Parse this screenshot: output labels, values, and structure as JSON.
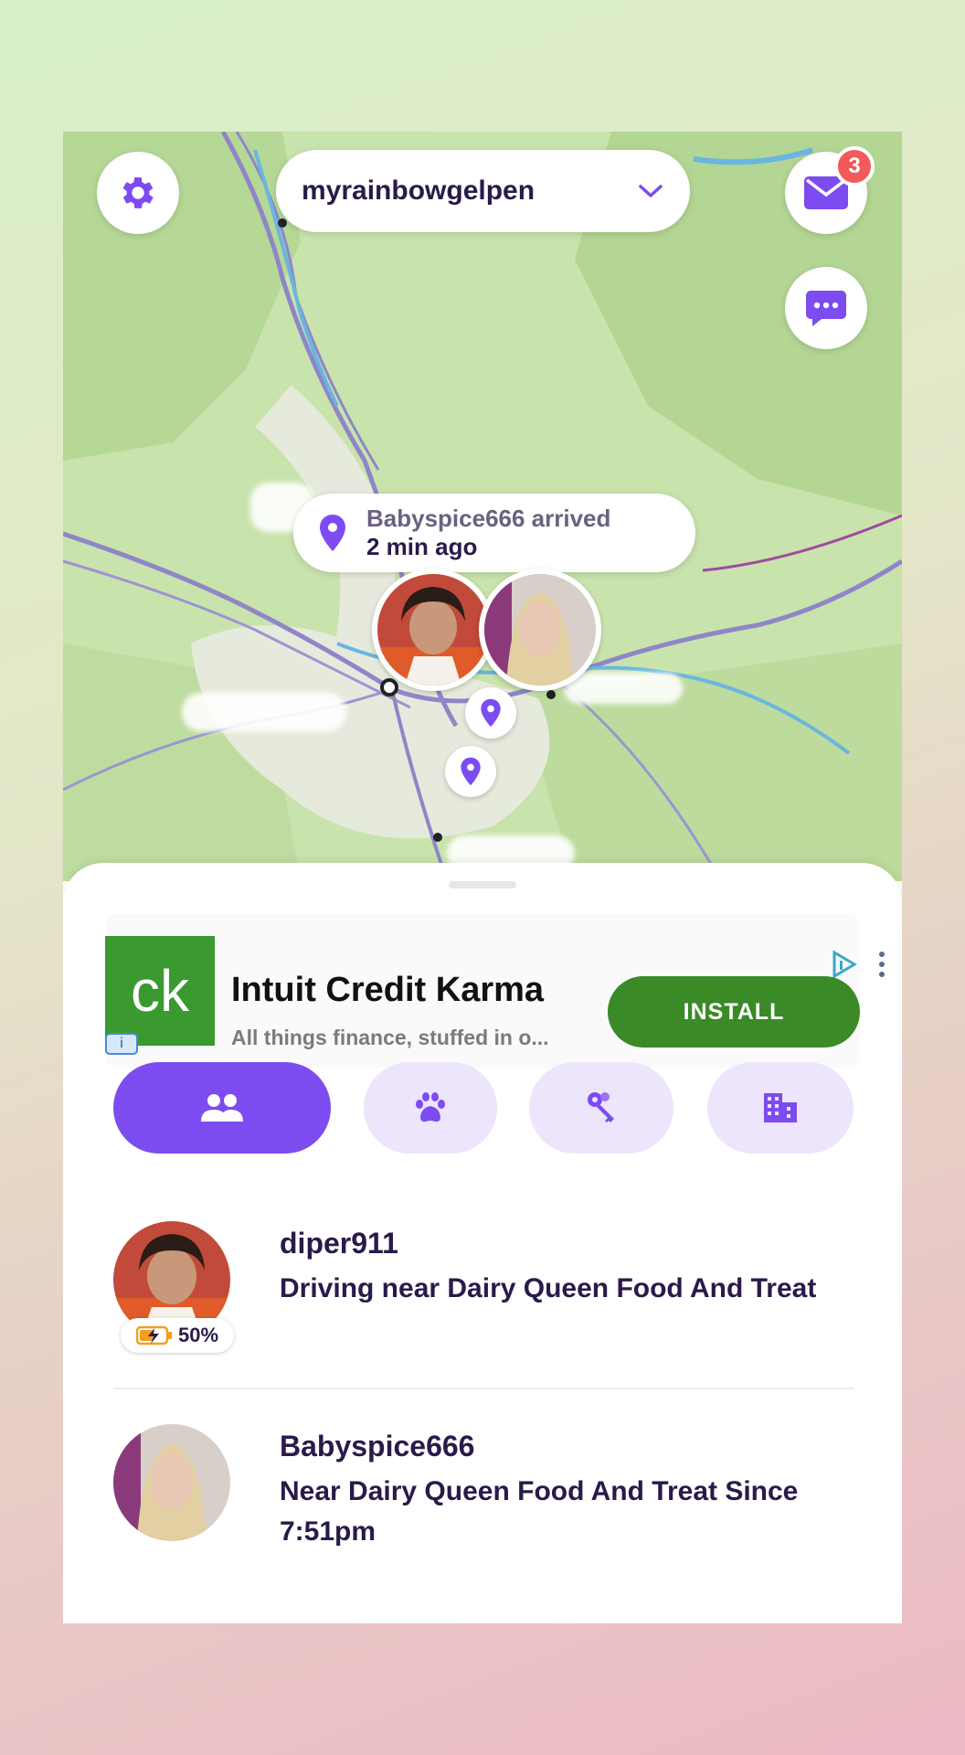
{
  "colors": {
    "accent": "#7c4cf0",
    "tab_inactive": "#ece5fb",
    "text_dark": "#2a1a4a",
    "badge": "#f05a5a",
    "ad_green": "#3a8a28"
  },
  "header": {
    "circle_name": "myrainbowgelpen",
    "mail_badge": "3",
    "icons": [
      "gear-icon",
      "chevron-down-icon",
      "mail-icon",
      "chat-icon"
    ]
  },
  "map": {
    "arrival_title": "Babyspice666 arrived",
    "arrival_time": "2 min ago"
  },
  "ad": {
    "logo_text": "ck",
    "title": "Intuit Credit Karma",
    "subtitle": "All things finance, stuffed in o...",
    "install_label": "INSTALL",
    "info_label": "i"
  },
  "tabs": [
    {
      "icon": "people-icon",
      "active": true
    },
    {
      "icon": "paw-icon",
      "active": false
    },
    {
      "icon": "keys-icon",
      "active": false
    },
    {
      "icon": "building-icon",
      "active": false
    }
  ],
  "members": [
    {
      "name": "diper911",
      "status": "Driving near Dairy Queen Food And Treat",
      "battery": "50%"
    },
    {
      "name": "Babyspice666",
      "status": "Near Dairy Queen Food And Treat Since 7:51pm"
    }
  ]
}
